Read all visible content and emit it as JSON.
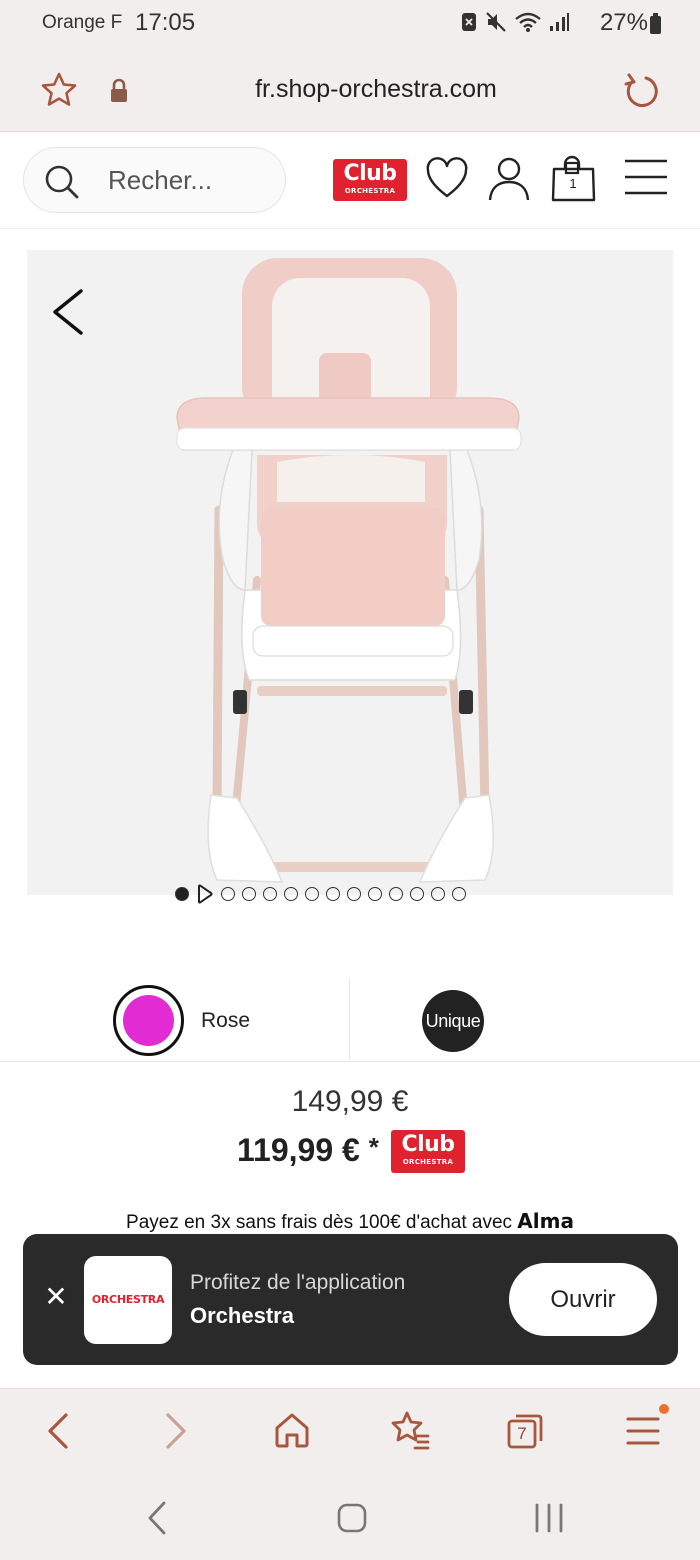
{
  "status_bar": {
    "carrier": "Orange F",
    "time": "17:05",
    "battery": "27%"
  },
  "browser": {
    "url": "fr.shop-orchestra.com",
    "tab_count": "7"
  },
  "header": {
    "search_placeholder": "Recher...",
    "club_logo_line1": "Club",
    "club_logo_line2": "ORCHESTRA",
    "cart_count": "1"
  },
  "gallery": {
    "image_count": 14,
    "active_index": 0
  },
  "variants": {
    "color_label": "Rose",
    "color_hex": "#e22bd2",
    "size_label": "Unique"
  },
  "price": {
    "original": "149,99 €",
    "club": "119,99 €",
    "asterisk": "*",
    "club_logo_line1": "Club",
    "club_logo_line2": "ORCHESTRA"
  },
  "payment": {
    "text": "Payez en 3x sans frais dès 100€ d'achat avec",
    "brand": "Alma"
  },
  "app_banner": {
    "logo_text": "ORCHESTRA",
    "line1": "Profitez de l'application",
    "line2": "Orchestra",
    "open_label": "Ouvrir"
  },
  "colors": {
    "brand_red": "#e0222f",
    "browser_icon_brown": "#a8573e",
    "banner_bg": "#2a2a2a"
  }
}
